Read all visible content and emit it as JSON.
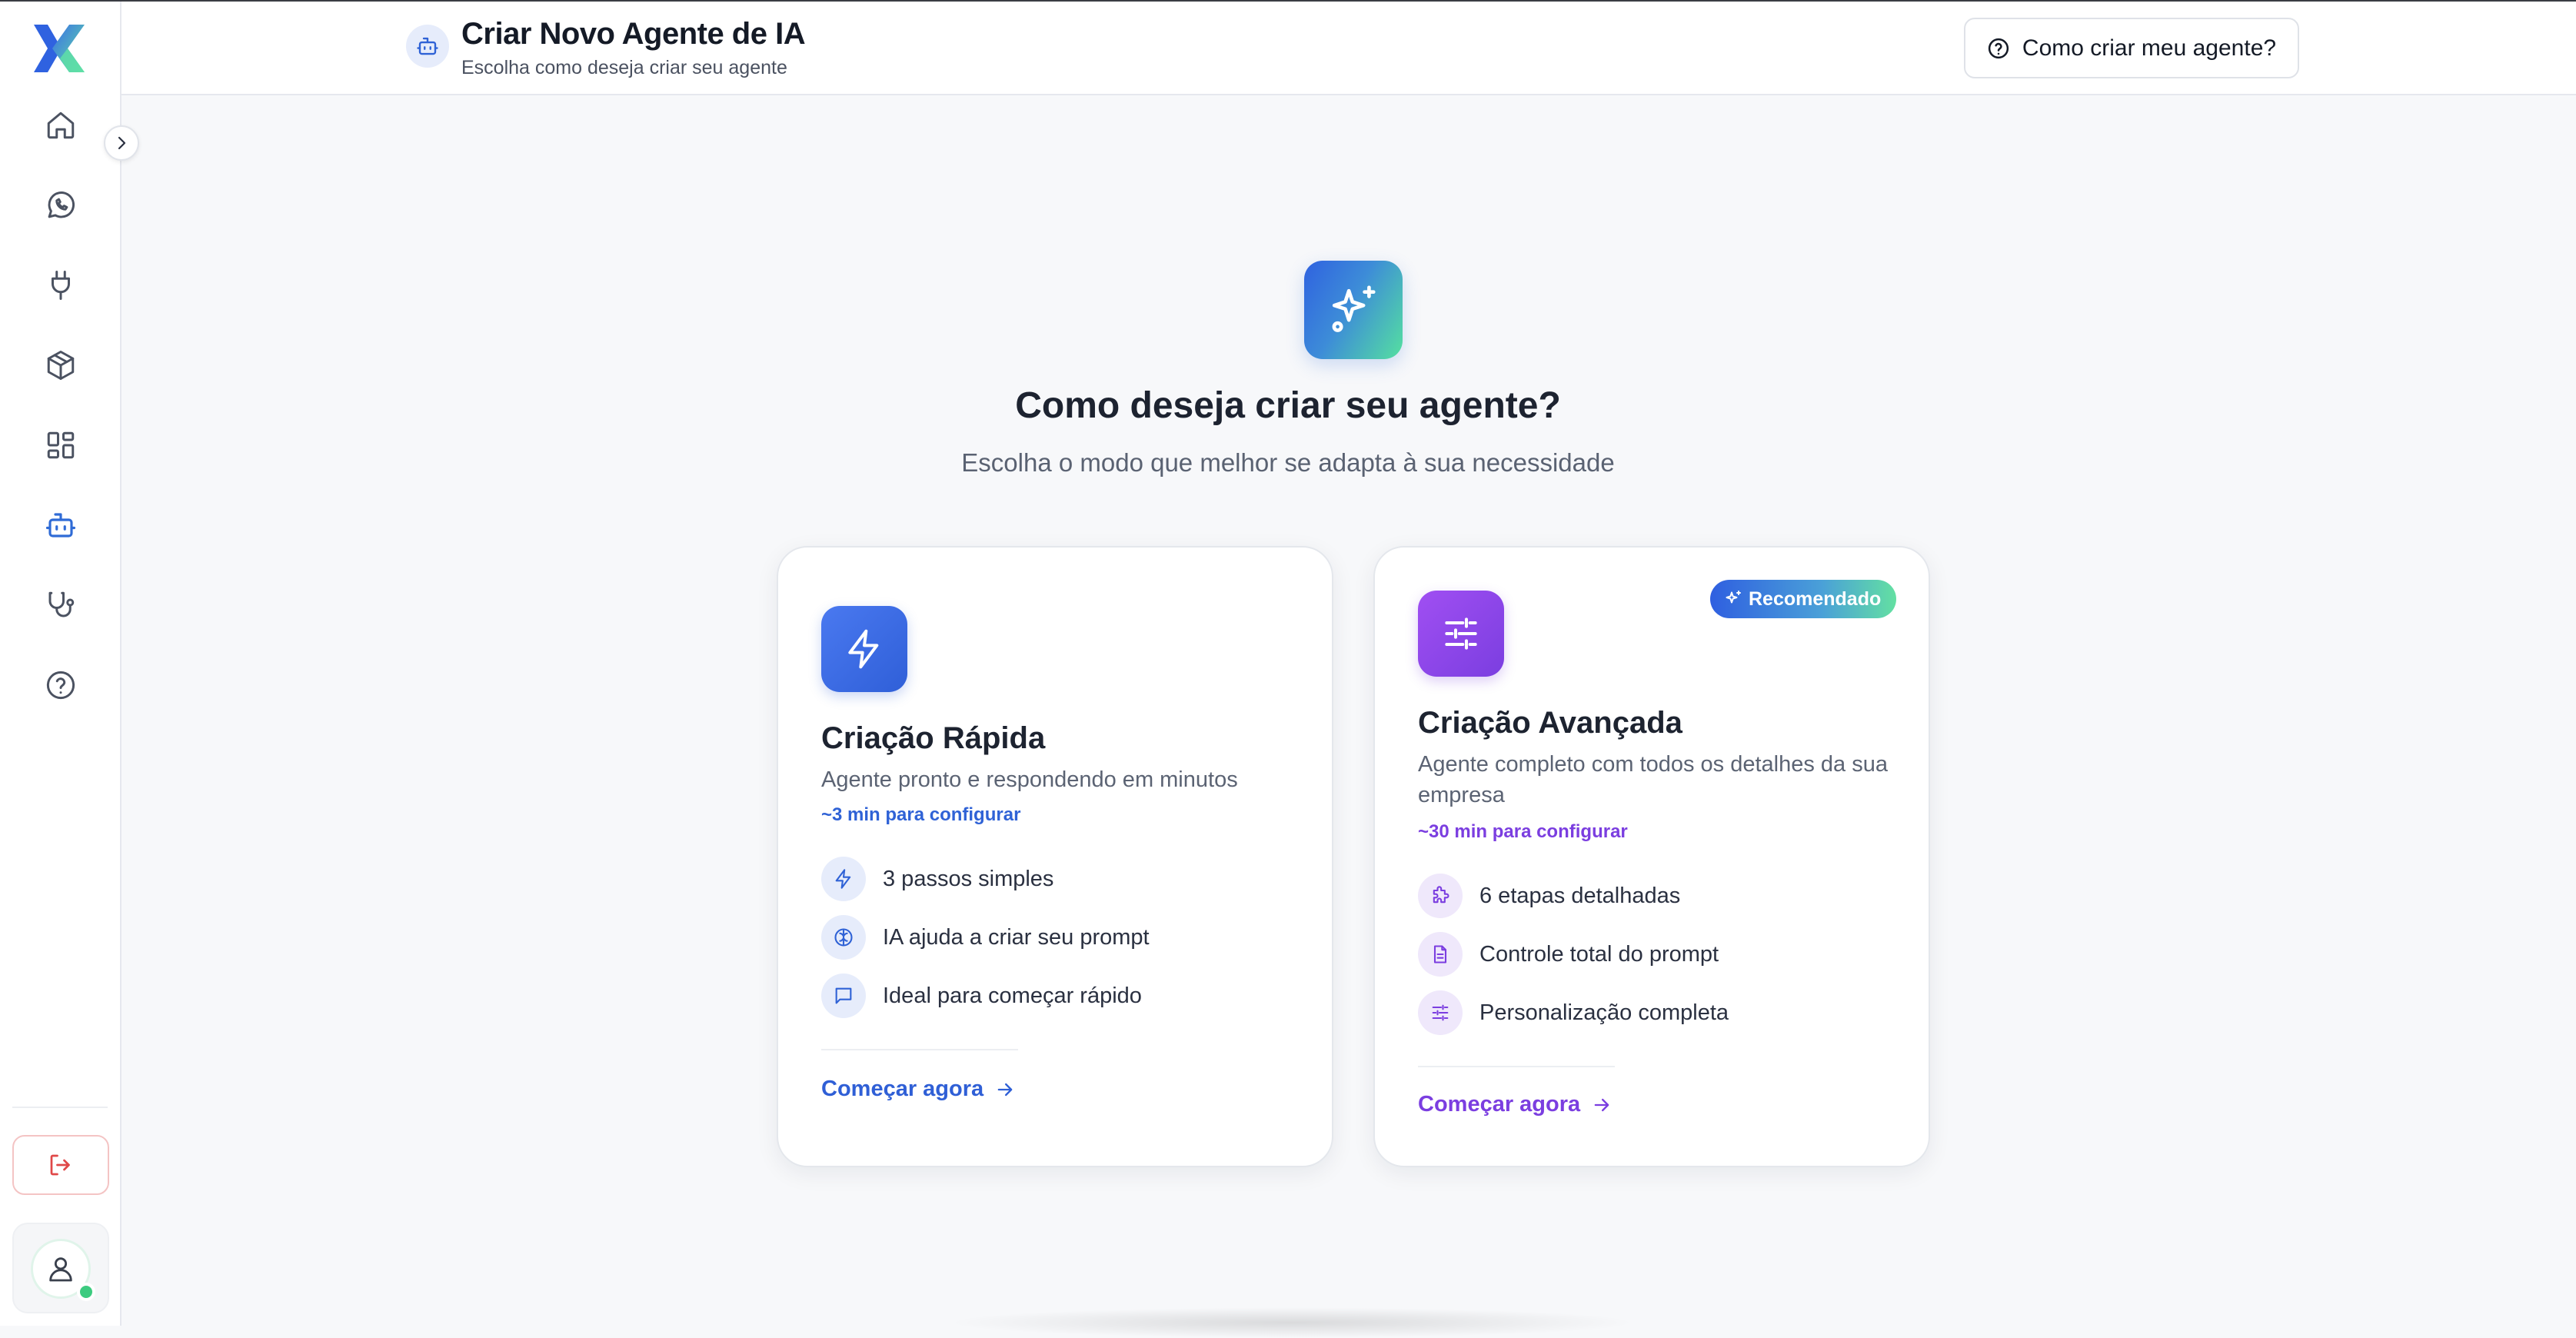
{
  "header": {
    "title": "Criar Novo Agente de IA",
    "subtitle": "Escolha como deseja criar seu agente",
    "help_button": "Como criar meu agente?"
  },
  "sidebar": {
    "items": [
      {
        "icon": "home-icon"
      },
      {
        "icon": "whatsapp-icon"
      },
      {
        "icon": "plug-icon"
      },
      {
        "icon": "package-icon"
      },
      {
        "icon": "dashboard-icon"
      },
      {
        "icon": "bot-icon",
        "active": true
      },
      {
        "icon": "stethoscope-icon"
      },
      {
        "icon": "help-circle-icon"
      }
    ],
    "status": "online"
  },
  "hero": {
    "title": "Como deseja criar seu agente?",
    "subtitle": "Escolha o modo que melhor se adapta à sua necessidade"
  },
  "cards": {
    "quick": {
      "title": "Criação Rápida",
      "description": "Agente pronto e respondendo em minutos",
      "time": "~3 min para configurar",
      "features": [
        "3 passos simples",
        "IA ajuda a criar seu prompt",
        "Ideal para começar rápido"
      ],
      "cta": "Começar agora"
    },
    "advanced": {
      "badge": "Recomendado",
      "title": "Criação Avançada",
      "description": "Agente completo com todos os detalhes da sua empresa",
      "time": "~30 min para configurar",
      "features": [
        "6 etapas detalhadas",
        "Controle total do prompt",
        "Personalização completa"
      ],
      "cta": "Começar agora"
    }
  },
  "colors": {
    "primary": "#2f5fd6",
    "accent_purple": "#7b3ee0",
    "success": "#3ccb7f",
    "danger": "#e04848"
  }
}
